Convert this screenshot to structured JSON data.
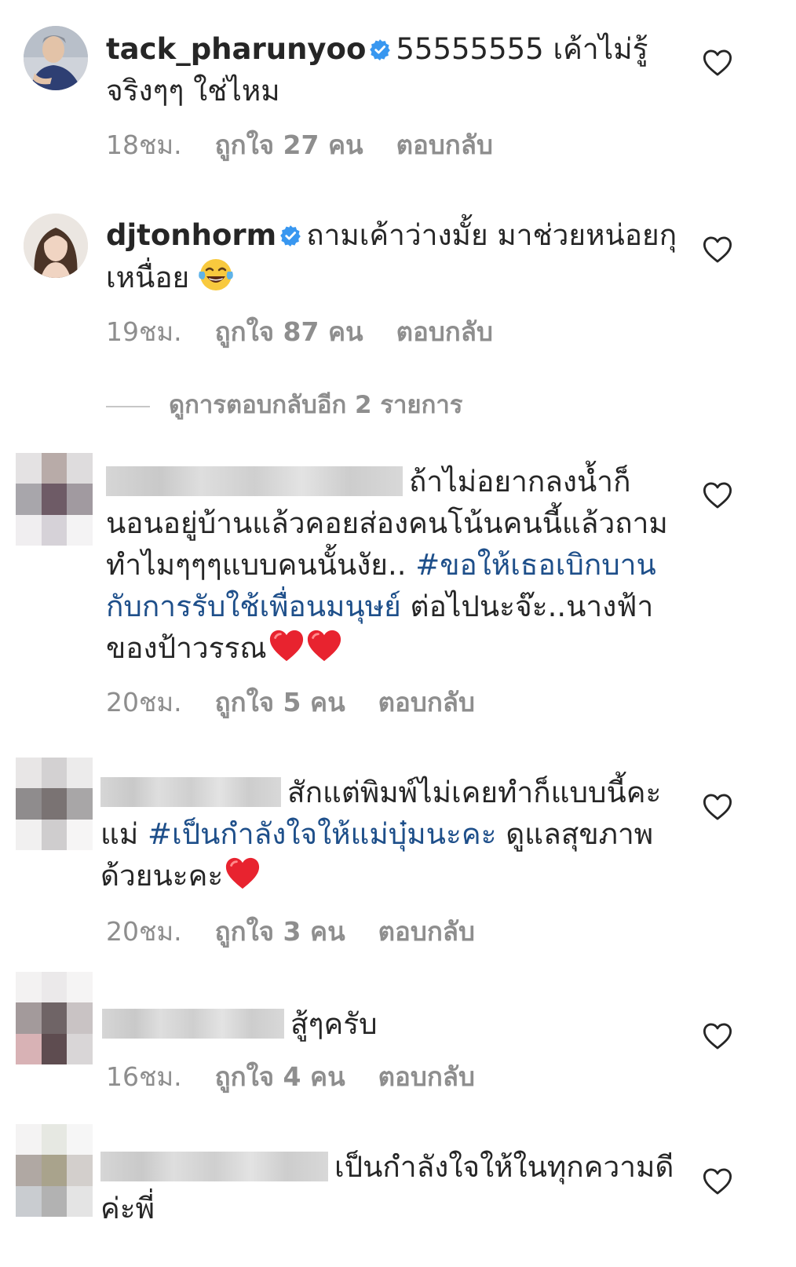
{
  "comments": [
    {
      "username": "tack_pharunyoo",
      "text": "55555555 เค้าไม่รู้จริงๆๆ ใช่ไหม",
      "time": "18ชม.",
      "likes": "ถูกใจ 27 คน",
      "reply": "ตอบกลับ"
    },
    {
      "username": "djtonhorm",
      "text": "ถามเค้าว่างมั้ย มาช่วยหน่อยกุเหนื่อย",
      "time": "19ชม.",
      "likes": "ถูกใจ 87 คน",
      "reply": "ตอบกลับ"
    },
    {
      "text_before": "ถ้าไม่อยากลงน้ำก็นอนอยู่บ้านแล้วคอยส่องคนโน้นคนนี้แล้วถามทำไมๆๆๆแบบคนนั้นงัย.. ",
      "hashtag": "#ขอให้เธอเบิกบานกับการรับใช้เพื่อนมนุษย์",
      "text_after": " ต่อไปนะจ๊ะ..นางฟ้าของป้าวรรณ",
      "time": "20ชม.",
      "likes": "ถูกใจ 5 คน",
      "reply": "ตอบกลับ"
    },
    {
      "text_before": "สักแต่พิมพ์ไม่เคยทำก็แบบนี้คะแม่ ",
      "hashtag": "#เป็นกำลังใจให้แม่บุ๋มนะคะ",
      "text_after": " ดูแลสุขภาพด้วยนะคะ",
      "time": "20ชม.",
      "likes": "ถูกใจ 3 คน",
      "reply": "ตอบกลับ"
    },
    {
      "text": "สู้ๆครับ",
      "time": "16ชม.",
      "likes": "ถูกใจ 4 คน",
      "reply": "ตอบกลับ"
    },
    {
      "text": "เป็นกำลังใจให้ในทุกความดีค่ะพี่"
    }
  ],
  "view_replies": "ดูการตอบกลับอีก 2 รายการ",
  "icons": {
    "verified": "verified-badge-icon",
    "like": "heart-outline-icon",
    "emoji_laugh": "face-with-tears-of-joy-icon",
    "emoji_heart": "red-heart-icon"
  },
  "colors": {
    "text": "#262626",
    "meta": "#8e8e8e",
    "hashtag": "#1e4f8a",
    "verified": "#3897f0"
  }
}
